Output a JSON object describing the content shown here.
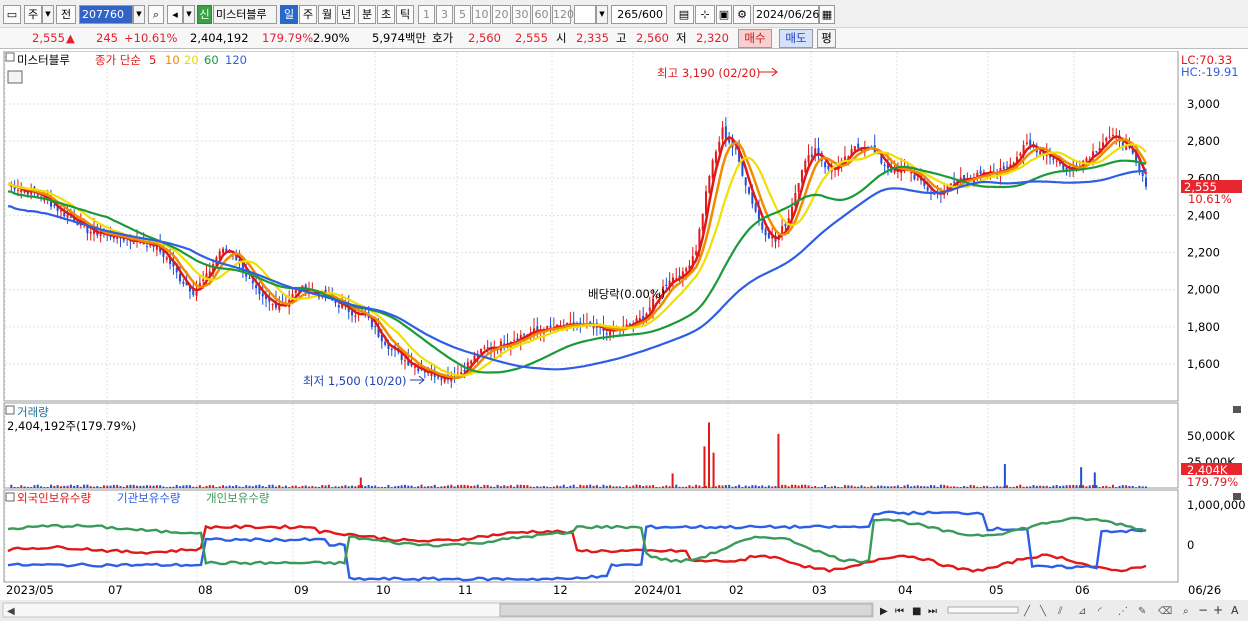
{
  "toolbar": {
    "market": "주",
    "period_prefix": "전",
    "stock_code": "207760",
    "new_badge": "신",
    "stock_name": "미스터블루",
    "period_tabs": [
      "일",
      "주",
      "월",
      "년",
      "분",
      "초",
      "틱"
    ],
    "active_period": "일",
    "interval_buttons": [
      "1",
      "3",
      "5",
      "10",
      "20",
      "30",
      "60",
      "120"
    ],
    "count_current": "265",
    "count_total": "/600",
    "date": "2024/06/26"
  },
  "quote": {
    "price": "2,555",
    "change": "245",
    "change_rate": "+10.61%",
    "volume": "2,404,192",
    "volume_ratio": "179.79%",
    "turnover": "2.90%",
    "amount": "5,974백만",
    "ask_label": "호가",
    "ask_value": "2,560",
    "bid_value": "2,555",
    "open_label": "시",
    "open": "2,335",
    "high_label": "고",
    "high": "2,560",
    "low_label": "저",
    "low": "2,320",
    "buy_button": "매수",
    "sell_button": "매도",
    "eval_button": "평"
  },
  "price_panel": {
    "stock_name": "미스터블루",
    "ma_label": "종가 단순",
    "ma_periods": [
      "5",
      "10",
      "20",
      "60",
      "120"
    ],
    "ma_colors": [
      "#e01818",
      "#f08c00",
      "#f0e000",
      "#1a9a3a",
      "#2e5ee6"
    ],
    "lc": "LC:70.33",
    "hc": "HC:-19.91",
    "high_annotation": "최고 3,190 (02/20)",
    "low_annotation": "최저 1,500 (10/20)",
    "dividend_annotation": "배당락(0.00%)",
    "current_price_tag": "2,555",
    "current_change_tag": "10.61%",
    "y_ticks": [
      "3,000",
      "2,800",
      "2,600",
      "2,400",
      "2,200",
      "2,000",
      "1,800",
      "1,600"
    ]
  },
  "volume_panel": {
    "title": "거래량",
    "value": "2,404,192주(179.79%)",
    "y_ticks": [
      "50,000K",
      "25,000K"
    ],
    "current_tag": "2,404K",
    "current_ratio": "179.79%"
  },
  "holding_panel": {
    "legend": [
      "외국인보유수량",
      "기관보유수량",
      "개인보유수량"
    ],
    "legend_colors": [
      "#e01818",
      "#2e5ee6",
      "#3a9a5a"
    ],
    "y_ticks": [
      "1,000,000",
      "0"
    ]
  },
  "x_axis": {
    "labels": [
      "2023/05",
      "07",
      "08",
      "09",
      "10",
      "11",
      "12",
      "2024/01",
      "02",
      "03",
      "04",
      "05",
      "06"
    ],
    "end_label": "06/26"
  },
  "chart_data": {
    "type": "candlestick",
    "title": "미스터블루",
    "x_range": [
      "2023/05",
      "2024/06/26"
    ],
    "price_axis": [
      1500,
      3100
    ],
    "high": {
      "value": 3190,
      "date": "02/20"
    },
    "low": {
      "value": 1500,
      "date": "10/20"
    },
    "close_series": [
      2570,
      2540,
      2520,
      2480,
      2420,
      2380,
      2320,
      2300,
      2290,
      2270,
      2260,
      2240,
      2170,
      2060,
      1990,
      2070,
      2210,
      2200,
      2080,
      1960,
      1920,
      1930,
      2010,
      1990,
      1960,
      1920,
      1880,
      1860,
      1760,
      1680,
      1620,
      1580,
      1550,
      1530,
      1540,
      1620,
      1680,
      1700,
      1730,
      1760,
      1780,
      1790,
      1800,
      1810,
      1800,
      1780,
      1780,
      1810,
      1850,
      1960,
      2060,
      2080,
      2220,
      2620,
      2860,
      2740,
      2520,
      2330,
      2260,
      2390,
      2660,
      2760,
      2640,
      2680,
      2760,
      2780,
      2690,
      2630,
      2650,
      2570,
      2510,
      2550,
      2600,
      2610,
      2620,
      2640,
      2700,
      2780,
      2750,
      2710,
      2640,
      2680,
      2740,
      2820,
      2810,
      2720,
      2555
    ],
    "ma_series_names": [
      "5",
      "10",
      "20",
      "60",
      "120"
    ],
    "volume_axis_k": [
      0,
      50000
    ],
    "volume_spikes_k": [
      {
        "month": "2024/01",
        "value": 63000
      },
      {
        "month": "2024/02",
        "value": 52000
      },
      {
        "month": "2024/05",
        "value": 23000
      },
      {
        "month": "2024/06",
        "value": 20000
      }
    ],
    "holding_series": [
      "외국인보유수량",
      "기관보유수량",
      "개인보유수량"
    ],
    "holding_axis": [
      -800000,
      1000000
    ]
  }
}
